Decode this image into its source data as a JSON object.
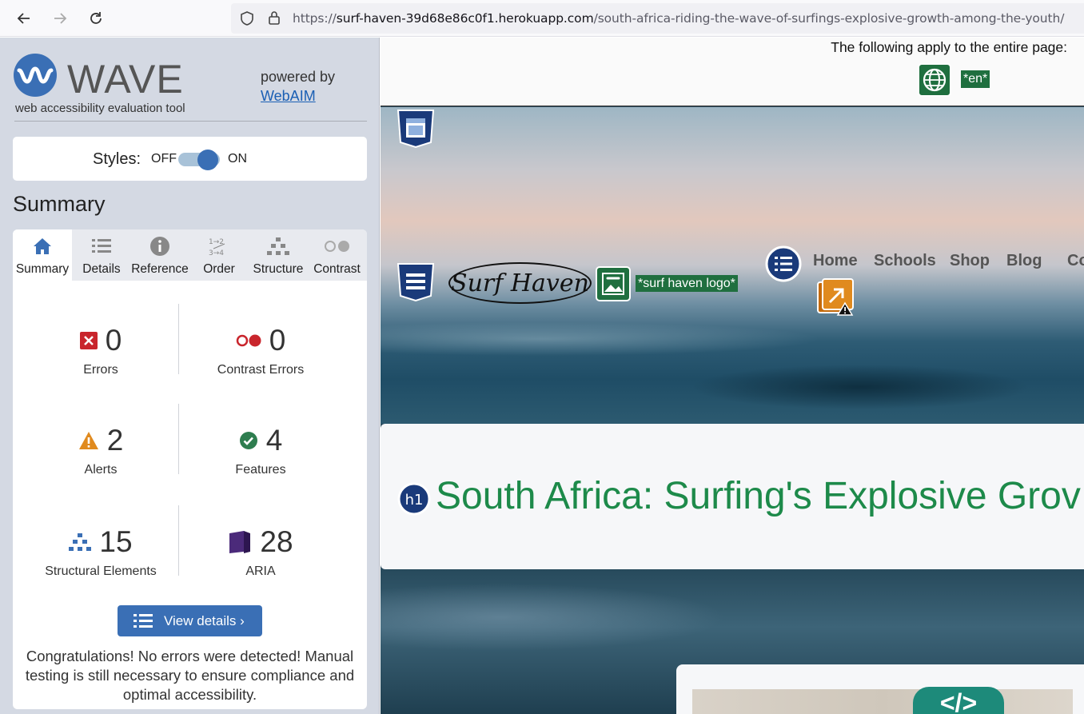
{
  "browser": {
    "url_scheme": "https://",
    "url_host": "surf-haven-39d68e86c0f1.herokuapp.com",
    "url_path": "/south-africa-riding-the-wave-of-surfings-explosive-growth-among-the-youth/"
  },
  "wave": {
    "brand": "WAVE",
    "subtitle": "web accessibility evaluation tool",
    "powered_by": "powered by",
    "powered_link": "WebAIM",
    "styles_label": "Styles:",
    "styles_off": "OFF",
    "styles_on": "ON",
    "summary_heading": "Summary",
    "tabs": [
      {
        "label": "Summary",
        "icon": "home-icon"
      },
      {
        "label": "Details",
        "icon": "list-icon"
      },
      {
        "label": "Reference",
        "icon": "info-icon"
      },
      {
        "label": "Order",
        "icon": "order-icon"
      },
      {
        "label": "Structure",
        "icon": "structure-icon"
      },
      {
        "label": "Contrast",
        "icon": "contrast-icon"
      }
    ],
    "stats": {
      "errors": {
        "count": "0",
        "label": "Errors"
      },
      "contrast_errors": {
        "count": "0",
        "label": "Contrast Errors"
      },
      "alerts": {
        "count": "2",
        "label": "Alerts"
      },
      "features": {
        "count": "4",
        "label": "Features"
      },
      "structural": {
        "count": "15",
        "label": "Structural Elements"
      },
      "aria": {
        "count": "28",
        "label": "ARIA"
      }
    },
    "view_details": "View details ›",
    "congrats": "Congratulations! No errors were detected! Manual testing is still necessary to ensure compliance and optimal accessibility."
  },
  "site": {
    "page_apply": "The following apply to the entire page:",
    "lang_tag": "*en*",
    "logo_text": "Surf Haven",
    "logo_alt": "*surf haven logo*",
    "nav": [
      "Home",
      "Schools",
      "Shop",
      "Blog",
      "Con"
    ],
    "h1_badge": "h1",
    "h1_text": "South Africa: Surfing's Explosive Grov",
    "code_badge": "</>"
  },
  "colors": {
    "wave_blue": "#3a6fb5",
    "error_red": "#c9252c",
    "alert_orange": "#e08a1e",
    "feature_green": "#2e7d4f",
    "aria_purple": "#4b2a7a",
    "heading_green": "#1d8a4a"
  }
}
